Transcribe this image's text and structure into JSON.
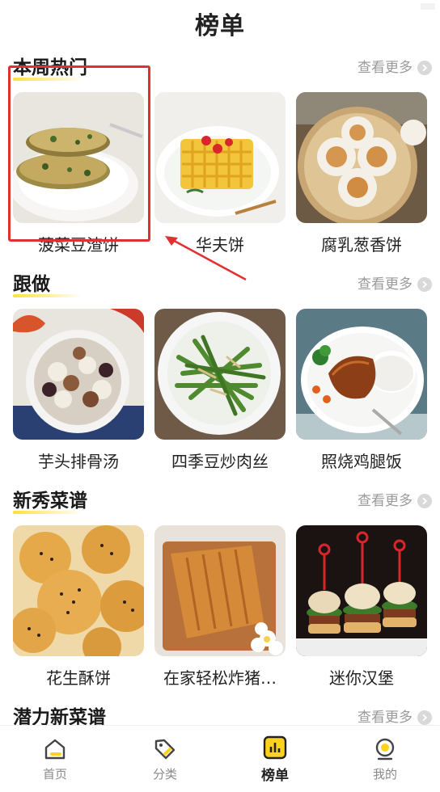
{
  "header": {
    "title": "榜单"
  },
  "more_label": "查看更多",
  "sections": [
    {
      "title": "本周热门",
      "items": [
        {
          "label": "菠菜豆渣饼"
        },
        {
          "label": "华夫饼"
        },
        {
          "label": "腐乳葱香饼"
        }
      ]
    },
    {
      "title": "跟做",
      "items": [
        {
          "label": "芋头排骨汤"
        },
        {
          "label": "四季豆炒肉丝"
        },
        {
          "label": "照烧鸡腿饭"
        }
      ]
    },
    {
      "title": "新秀菜谱",
      "items": [
        {
          "label": "花生酥饼"
        },
        {
          "label": "在家轻松炸猪…"
        },
        {
          "label": "迷你汉堡"
        }
      ]
    },
    {
      "title": "潜力新菜谱"
    }
  ],
  "tabbar": {
    "tabs": [
      {
        "label": "首页"
      },
      {
        "label": "分类"
      },
      {
        "label": "榜单"
      },
      {
        "label": "我的"
      }
    ],
    "active": "榜单"
  },
  "colors": {
    "accent_yellow": "#ffe13a",
    "highlight_red": "#e23030",
    "muted_text": "#9a9a9a"
  }
}
